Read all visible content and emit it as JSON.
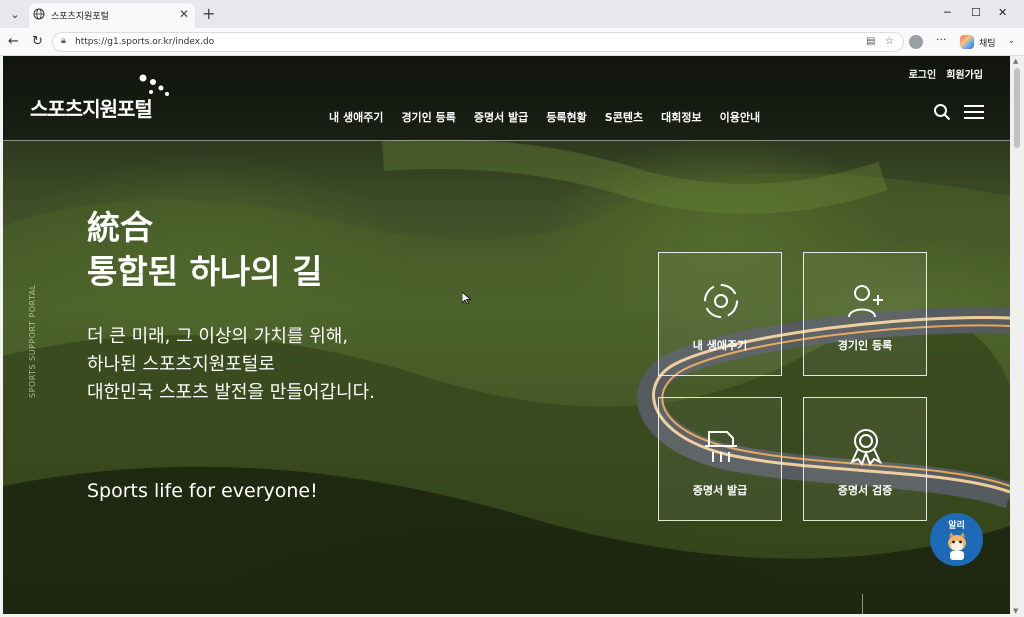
{
  "browser": {
    "tab_title": "스포츠지원포털",
    "url": "https://g1.sports.or.kr/index.do",
    "chat_label": "채팅"
  },
  "header": {
    "logo_text": "스포츠지원포털",
    "top_links": [
      "로그인",
      "회원가입"
    ],
    "nav_items": [
      "내 생애주기",
      "경기인 등록",
      "증명서 발급",
      "등록현황",
      "S콘텐츠",
      "대회정보",
      "이용안내"
    ]
  },
  "hero": {
    "side_text": "SPORTS SUPPORT PORTAL",
    "title_line1": "統合",
    "title_line2": "통합된 하나의 길",
    "sub_line1": "더 큰 미래, 그 이상의 가치를 위해,",
    "sub_line2": "하나된 스포츠지원포털로",
    "sub_line3": "대한민국 스포츠 발전을 만들어갑니다.",
    "tagline": "Sports life for everyone!"
  },
  "quick_cards": [
    {
      "label": "내 생애주기",
      "icon": "lifecycle-icon"
    },
    {
      "label": "경기인 등록",
      "icon": "user-add-icon"
    },
    {
      "label": "증명서 발급",
      "icon": "printer-icon"
    },
    {
      "label": "증명서 검증",
      "icon": "badge-icon"
    }
  ],
  "chatbot": {
    "label": "알리"
  },
  "colors": {
    "chatbot_bg": "#1d6bb8",
    "header_bg": "#0a0c0a"
  }
}
